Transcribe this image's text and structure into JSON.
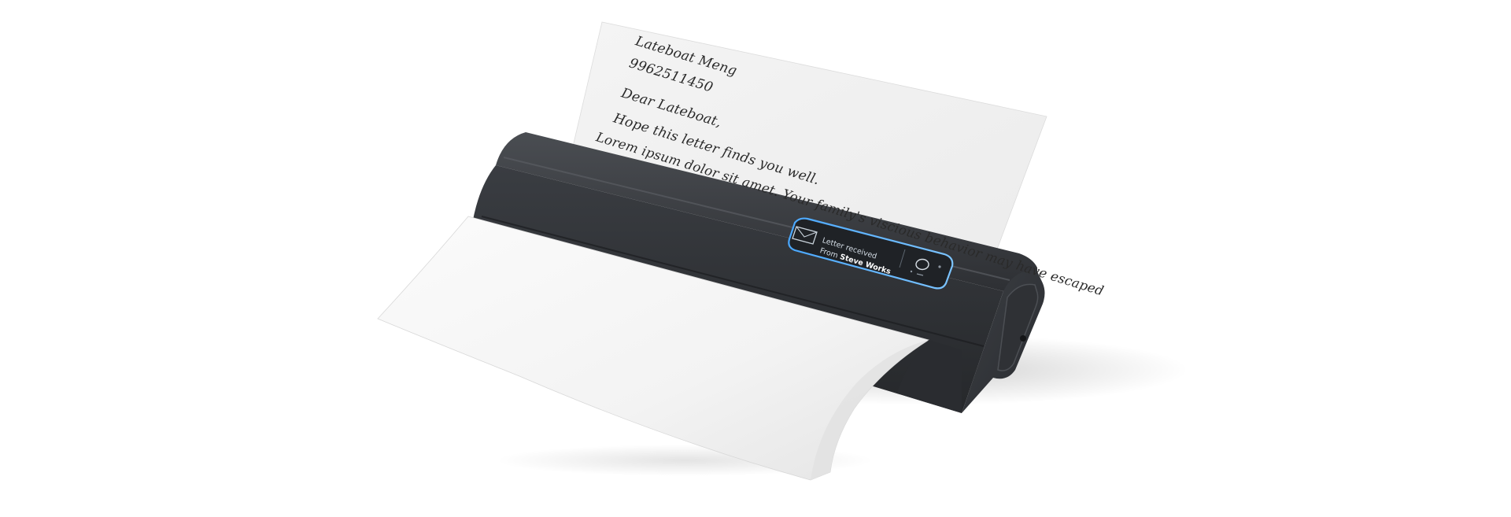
{
  "scene": {
    "description_label": "letter-printer-product-render"
  },
  "letter": {
    "name": "Lateboat Meng",
    "phone": "9962511450",
    "greeting": "Dear Lateboat,",
    "line1": "Hope this letter finds you well.",
    "line2": "Lorem ipsum dolor sit amet. Your family's viscious behavior may have escaped"
  },
  "notification": {
    "title": "Letter received",
    "from_prefix": "From ",
    "from_name": "Steve Works",
    "icon": "envelope-icon",
    "button_icon": "power-ring-icon",
    "accent_color": "#4aa8ff"
  },
  "colors": {
    "printer_body": "#3a3d42",
    "printer_dark": "#232528",
    "paper": "#f7f7f7",
    "paper_shadow": "#e6e6e6"
  }
}
